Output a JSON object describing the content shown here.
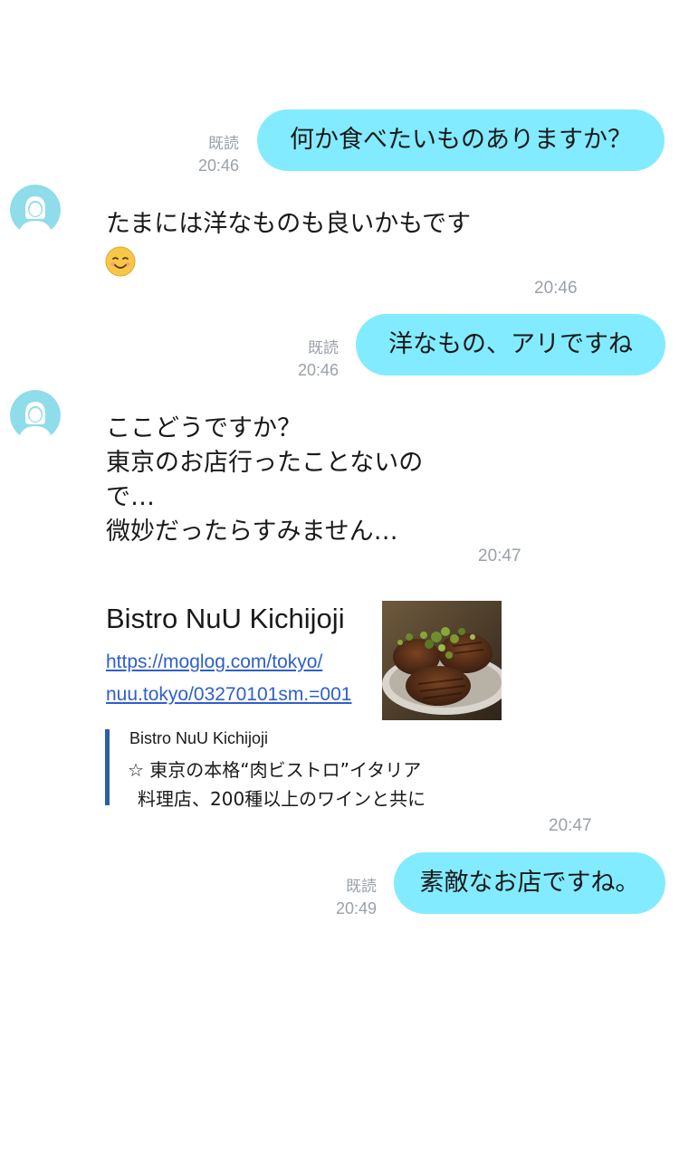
{
  "messages": [
    {
      "type": "out",
      "text": "何か食べたいものありますか？",
      "read": "既読",
      "time": "20:46"
    },
    {
      "type": "in",
      "lines": [
        "たまには洋なものも良いかもです"
      ],
      "emoji": "smiling-face-emoji",
      "time": "20:46"
    },
    {
      "type": "out",
      "text": "洋なもの、アリですね",
      "read": "既読",
      "time": "20:46"
    },
    {
      "type": "in",
      "lines": [
        "ここどうですか？",
        "東京のお店行ったことないの",
        "で…",
        "微妙だったらすみません…"
      ],
      "time": "20:47"
    },
    {
      "type": "link",
      "title": "Bistro NuU Kichijoji",
      "url_lines": [
        "https://moglog.com/tokyo/",
        "nuu.tokyo/03270101sm.=001"
      ],
      "site": "Bistro NuU Kichijoji",
      "desc_lines": [
        "☆ 東京の本格“肉ビストロ”イタリア",
        "料理店、200種以上のワインと共に"
      ],
      "time": "20:47"
    },
    {
      "type": "out",
      "text": "素敵なお店ですね。",
      "read": "既読",
      "time": "20:49"
    }
  ],
  "colors": {
    "bubble_out": "#82ebff",
    "meta_text": "#9aa1a8",
    "link": "#2f5fc9",
    "quote_bar": "#2b5fa8",
    "avatar_bg": "#8fdcea"
  }
}
